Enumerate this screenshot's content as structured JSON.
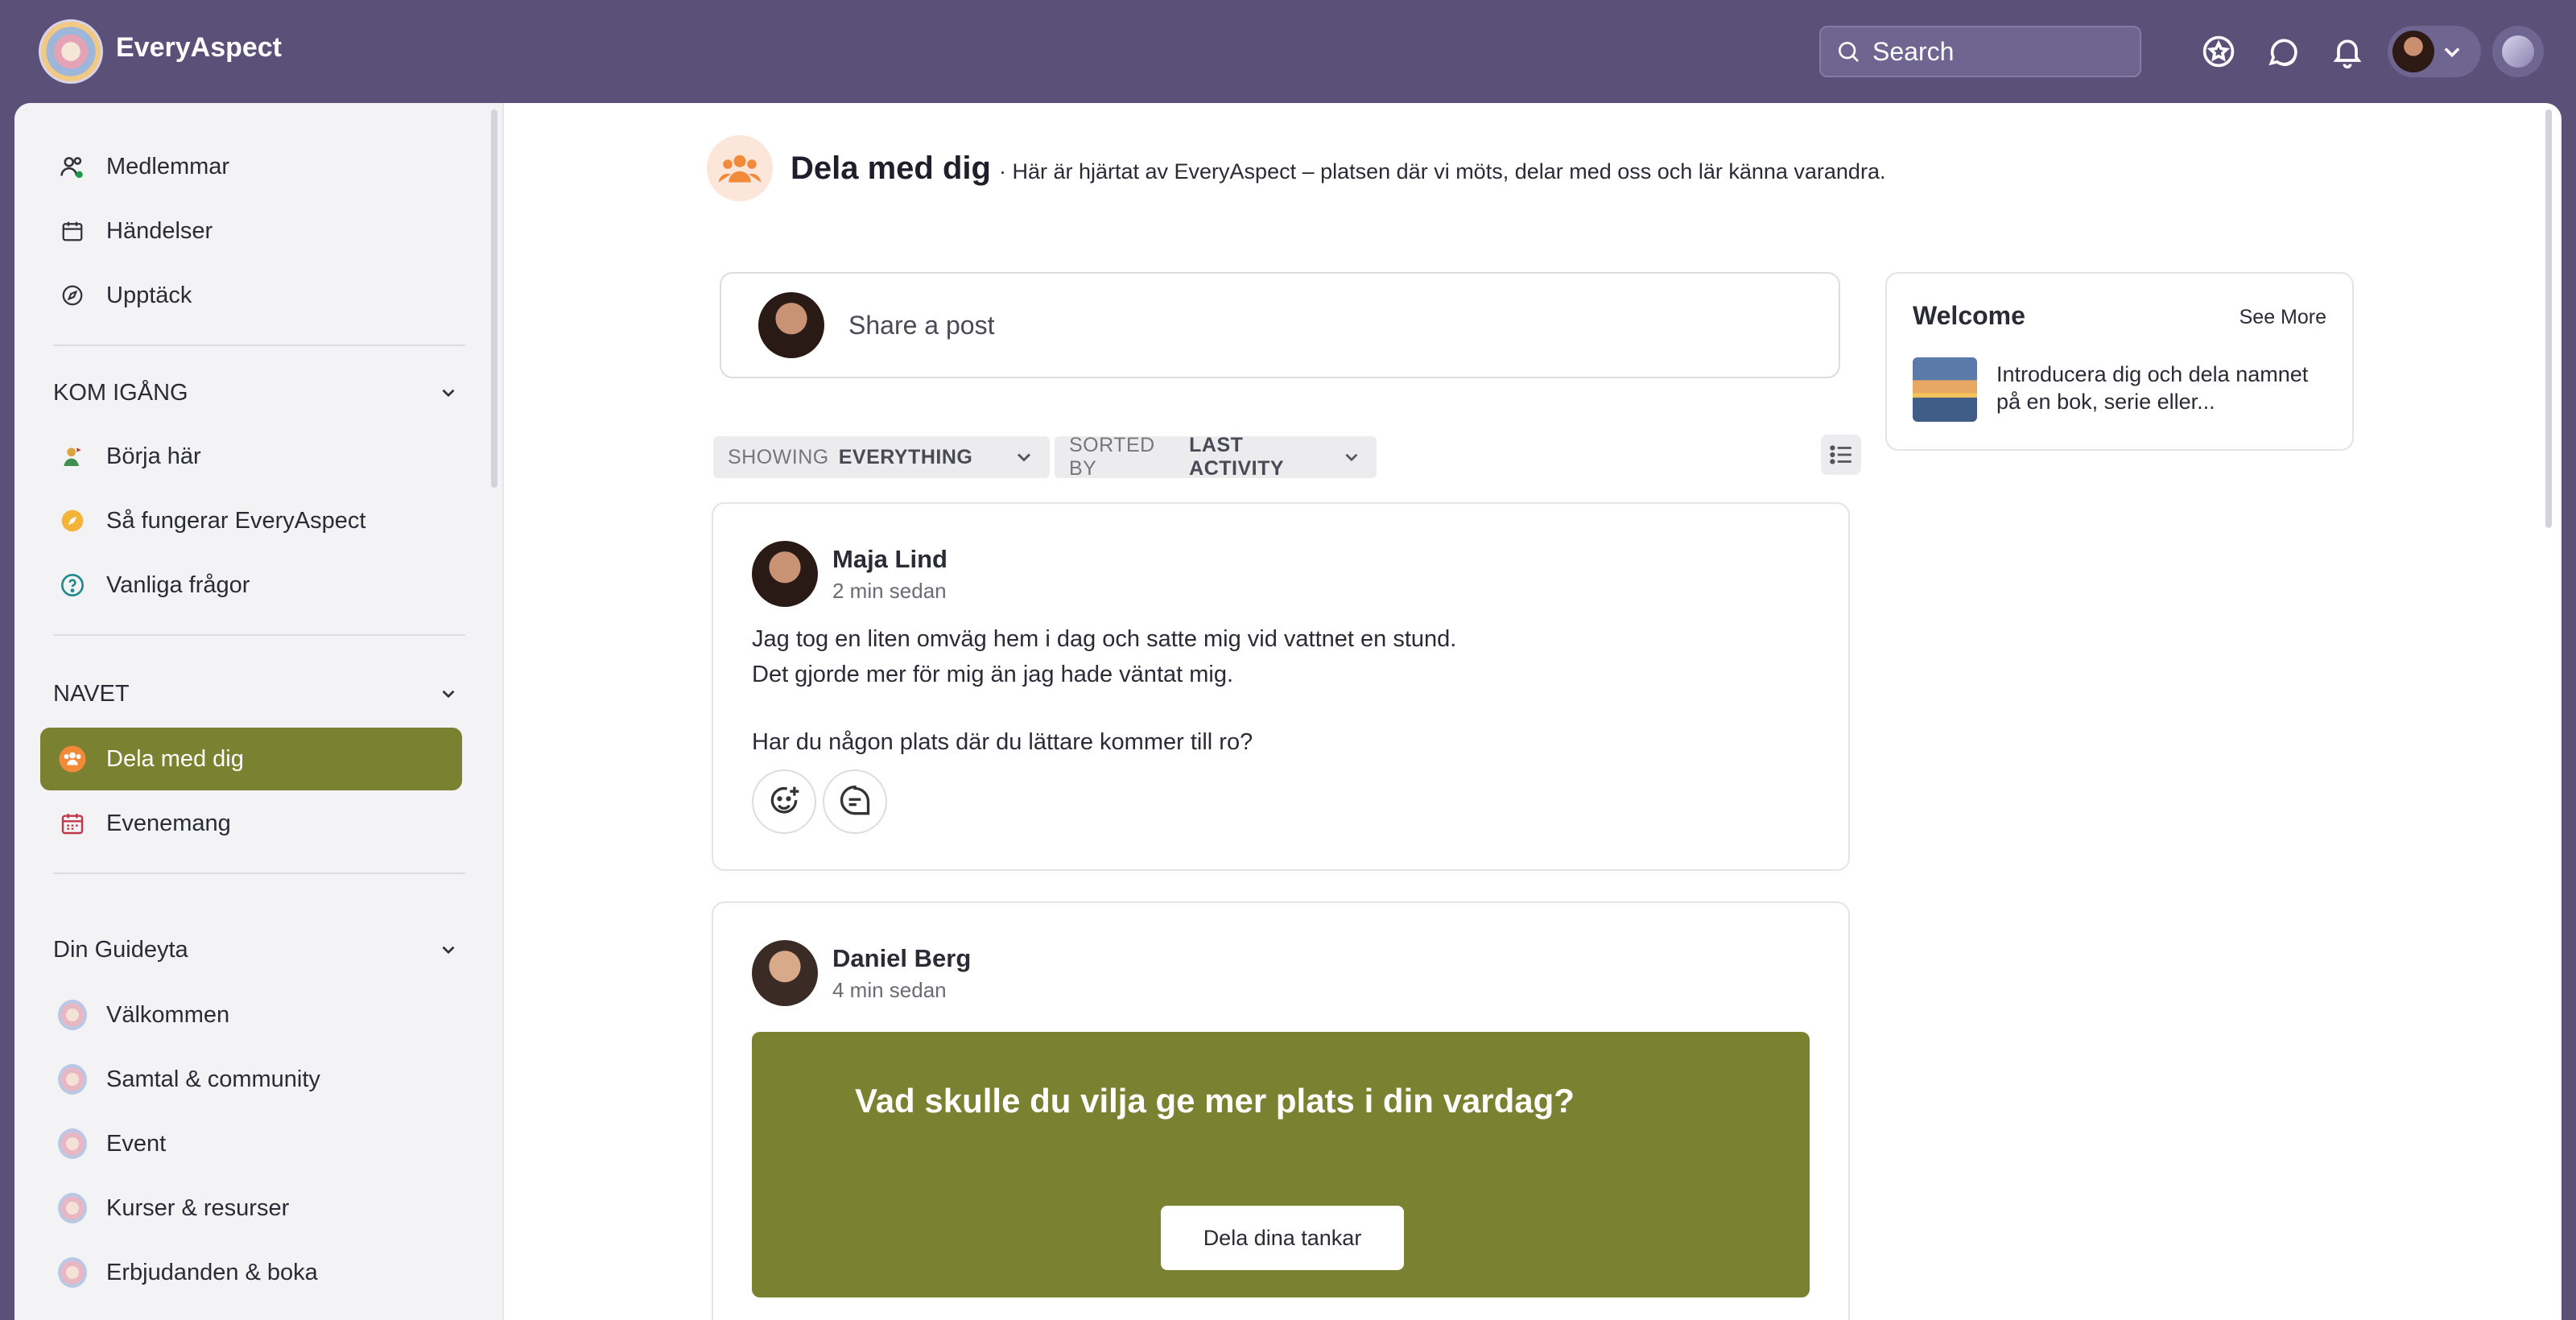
{
  "header": {
    "brand": "EveryAspect",
    "search_placeholder": "Search"
  },
  "sidebar": {
    "top_items": [
      {
        "label": "Medlemmar",
        "icon": "members-icon"
      },
      {
        "label": "Händelser",
        "icon": "calendar-icon"
      },
      {
        "label": "Upptäck",
        "icon": "compass-icon"
      }
    ],
    "sections": [
      {
        "title": "KOM IGÅNG",
        "items": [
          {
            "label": "Börja här",
            "icon": "start-icon"
          },
          {
            "label": "Så fungerar EveryAspect",
            "icon": "compass-orange-icon"
          },
          {
            "label": "Vanliga frågor",
            "icon": "question-icon"
          }
        ]
      },
      {
        "title": "NAVET",
        "items": [
          {
            "label": "Dela med dig",
            "icon": "group-icon",
            "active": true
          },
          {
            "label": "Evenemang",
            "icon": "event-calendar-icon"
          }
        ]
      },
      {
        "title": "Din Guideyta",
        "items": [
          {
            "label": "Välkommen"
          },
          {
            "label": "Samtal & community"
          },
          {
            "label": "Event"
          },
          {
            "label": "Kurser & resurser"
          },
          {
            "label": "Erbjudanden & boka"
          }
        ]
      }
    ]
  },
  "page": {
    "title": "Dela med dig",
    "description": "· Här är hjärtat av EveryAspect – platsen där vi möts, delar med oss och lär känna varandra."
  },
  "composer": {
    "placeholder": "Share a post"
  },
  "filters": {
    "showing_prefix": "SHOWING",
    "showing_value": "EVERYTHING",
    "sorted_prefix": "SORTED BY",
    "sorted_value": "LAST ACTIVITY"
  },
  "posts": [
    {
      "author": "Maja Lind",
      "time": "2 min sedan",
      "lines": [
        "Jag tog en liten omväg hem i dag och satte mig vid vattnet en stund.",
        "Det gjorde mer för mig än jag hade väntat mig.",
        "",
        "Har du någon plats där du lättare kommer till ro?"
      ]
    },
    {
      "author": "Daniel Berg",
      "time": "4 min sedan",
      "banner_question": "Vad skulle du vilja ge mer plats i din vardag?",
      "banner_button": "Dela dina tankar"
    }
  ],
  "welcome": {
    "title": "Welcome",
    "see_more": "See More",
    "item_text": "Introducera dig och dela namnet på en bok, serie eller..."
  },
  "colors": {
    "header_bg": "#5a5078",
    "accent_olive": "#7a8231"
  }
}
